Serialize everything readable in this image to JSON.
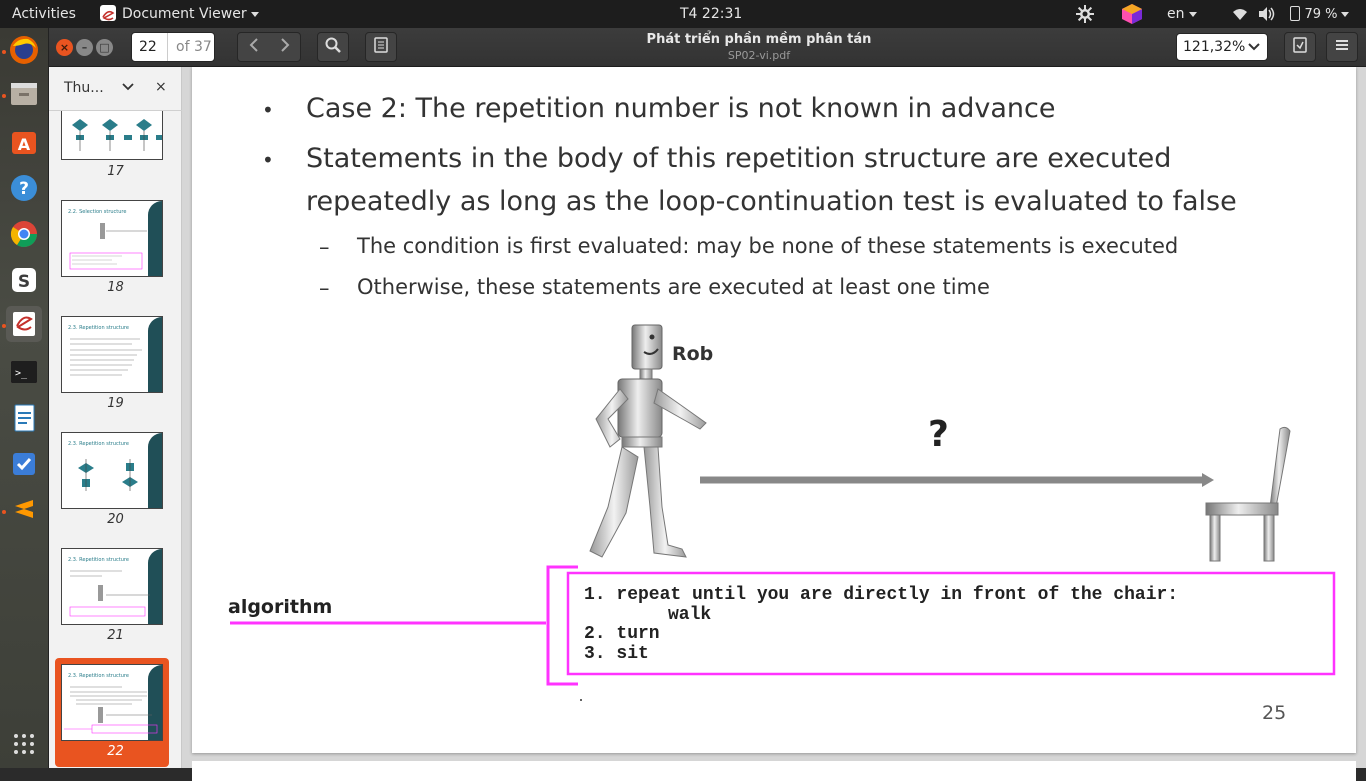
{
  "topbar": {
    "activities": "Activities",
    "app_menu": "Document Viewer",
    "clock": "T4 22:31",
    "lang": "en",
    "battery": "79 %"
  },
  "header": {
    "page_number": "22",
    "page_total": "of 37",
    "title": "Phát triển phần mềm phân tán",
    "subtitle": "SP02-vi.pdf",
    "zoom": "121,32%"
  },
  "sidebar": {
    "title": "Thu...",
    "thumbnails": [
      {
        "label": "17",
        "heading": ""
      },
      {
        "label": "18",
        "heading": "2.2. Selection structure"
      },
      {
        "label": "19",
        "heading": "2.3. Repetition structure"
      },
      {
        "label": "20",
        "heading": "2.3. Repetition structure"
      },
      {
        "label": "21",
        "heading": "2.3. Repetition structure"
      },
      {
        "label": "22",
        "heading": "2.3. Repetition structure"
      }
    ]
  },
  "slide": {
    "bullet1": "Case 2: The repetition number is not known in advance",
    "bullet2_line1": "Statements in the body of this repetition structure are executed",
    "bullet2_line2": "repeatedly as long as the loop-continuation test is evaluated to false",
    "sub1": "The condition is first evaluated: may be none of these statements is executed",
    "sub2": "Otherwise, these statements are executed at least one time",
    "robot_label": "Rob",
    "question": "?",
    "algorithm_label": "algorithm",
    "algo_line1": "1. repeat until you are directly in front of the chair:",
    "algo_line1b": "walk",
    "algo_line2": "2. turn",
    "algo_line3": "3. sit",
    "page_number": "25",
    "accent_color": "#ff33ff"
  }
}
